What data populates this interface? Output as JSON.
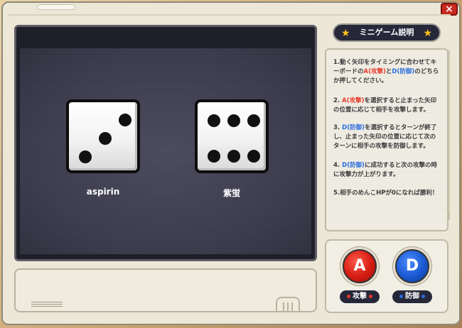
{
  "window": {
    "close_label": "×"
  },
  "screen": {
    "players": [
      {
        "name": "aspirin",
        "die_value": 3
      },
      {
        "name": "紫蛍",
        "die_value": 6
      }
    ]
  },
  "panel": {
    "title": "ミニゲーム説明",
    "rules": [
      "1.動く矢印をタイミングに合わせてキーボードのA(攻撃)とD(防御)のどちらか押してください。",
      "2. A(攻撃)を選択すると止まった矢印の位置に応じて相手を攻撃します。",
      "3. D(防御)を選択するとターンが終了し、止まった矢印の位置に応じて次のターンに相手の攻撃を防御します。",
      "4. D(防御)に成功すると次の攻撃の時に攻撃力が上がります。",
      "5.相手のめんこHPが0になれば勝利！"
    ]
  },
  "controls": {
    "attack_key": "A",
    "attack_label": "攻撃",
    "defend_key": "D",
    "defend_label": "防御"
  },
  "colors": {
    "attack": "#d51c12",
    "defend": "#1a58d1",
    "accent_star": "#ffc21a"
  }
}
